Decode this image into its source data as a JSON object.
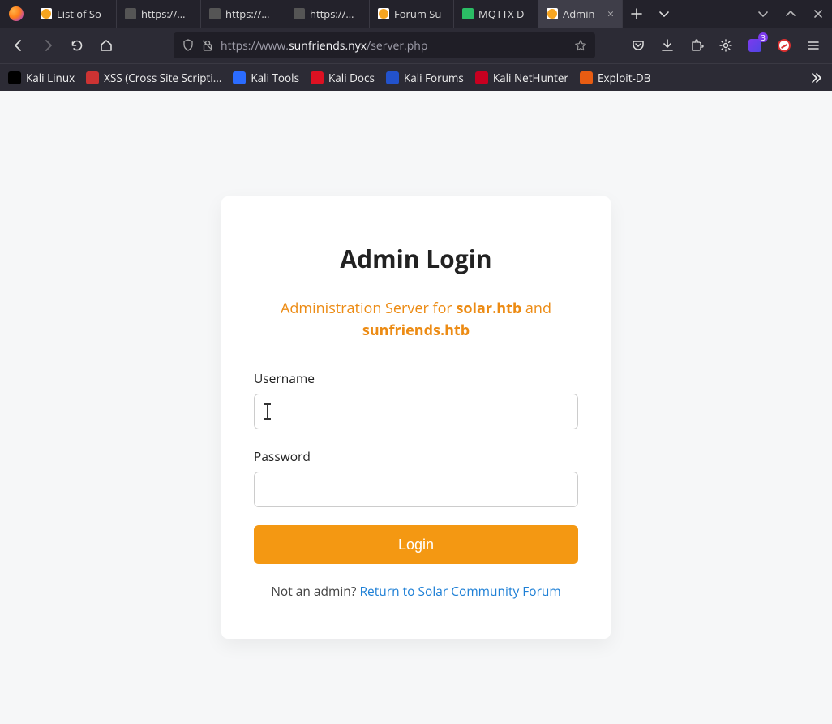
{
  "tabs": [
    {
      "label": "List of So",
      "favicon": "sun",
      "active": false,
      "close": false
    },
    {
      "label": "https://www",
      "favicon": "globe",
      "active": false,
      "close": false
    },
    {
      "label": "https://www",
      "favicon": "globe",
      "active": false,
      "close": false
    },
    {
      "label": "https://www",
      "favicon": "globe",
      "active": false,
      "close": false
    },
    {
      "label": "Forum Su",
      "favicon": "sun",
      "active": false,
      "close": false
    },
    {
      "label": "MQTTX D",
      "favicon": "mqtt",
      "active": false,
      "close": false
    },
    {
      "label": "Admin",
      "favicon": "sun",
      "active": true,
      "close": true
    }
  ],
  "url": {
    "protocol": "https://www.",
    "host": "sunfriends.nyx",
    "path": "/server.php"
  },
  "bookmarks": [
    {
      "icon": "bi-kali",
      "label": "Kali Linux"
    },
    {
      "icon": "bi-xss",
      "label": "XSS (Cross Site Scripti..."
    },
    {
      "icon": "bi-tools",
      "label": "Kali Tools"
    },
    {
      "icon": "bi-docs",
      "label": "Kali Docs"
    },
    {
      "icon": "bi-forums",
      "label": "Kali Forums"
    },
    {
      "icon": "bi-nh",
      "label": "Kali NetHunter"
    },
    {
      "icon": "bi-edb",
      "label": "Exploit-DB"
    }
  ],
  "ext_badge": "3",
  "page": {
    "title": "Admin Login",
    "subtitle_pre": "Administration Server for ",
    "subtitle_b1": "solar.htb",
    "subtitle_mid": " and ",
    "subtitle_b2": "sunfriends.htb",
    "username_label": "Username",
    "username_value": "",
    "password_label": "Password",
    "password_value": "",
    "login_btn": "Login",
    "foot_pre": "Not an admin? ",
    "foot_link": "Return to Solar Community Forum"
  }
}
